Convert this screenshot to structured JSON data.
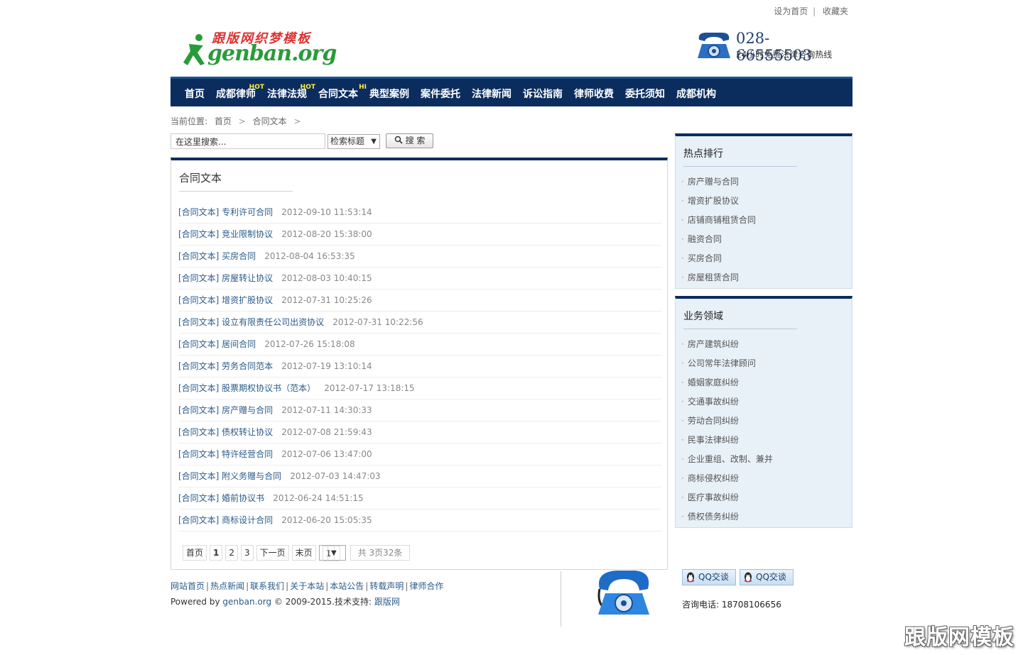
{
  "top_links": [
    "设为首页",
    "收藏夹"
  ],
  "top_sep": "|",
  "logo": {
    "cn": "跟版网织梦模板",
    "en": "genban.org"
  },
  "hotline": {
    "number": "028-66555503",
    "sub": "24小时免费法律咨询热线"
  },
  "nav": [
    {
      "label": "首页",
      "badge": ""
    },
    {
      "label": "成都律师",
      "badge": "HOT"
    },
    {
      "label": "法律法规",
      "badge": "HOT"
    },
    {
      "label": "合同文本",
      "badge": "HI"
    },
    {
      "label": "典型案例",
      "badge": ""
    },
    {
      "label": "案件委托",
      "badge": ""
    },
    {
      "label": "法律新闻",
      "badge": ""
    },
    {
      "label": "诉讼指南",
      "badge": ""
    },
    {
      "label": "律师收费",
      "badge": ""
    },
    {
      "label": "委托须知",
      "badge": ""
    },
    {
      "label": "成都机构",
      "badge": ""
    }
  ],
  "breadcrumb": {
    "prefix": "当前位置:",
    "items": [
      "首页",
      "合同文本"
    ],
    "arrow": ">"
  },
  "search": {
    "value": "在这里搜索...",
    "scope": "检索标题",
    "button": "搜 索"
  },
  "main": {
    "title": "合同文本",
    "items": [
      {
        "title": "[合同文本] 专利许可合同",
        "date": "2012-09-10 11:53:14"
      },
      {
        "title": "[合同文本] 竞业限制协议",
        "date": "2012-08-20 15:38:00"
      },
      {
        "title": "[合同文本] 买房合同",
        "date": "2012-08-04 16:53:35"
      },
      {
        "title": "[合同文本] 房屋转让协议",
        "date": "2012-08-03 10:40:15"
      },
      {
        "title": "[合同文本] 增资扩股协议",
        "date": "2012-07-31 10:25:26"
      },
      {
        "title": "[合同文本] 设立有限责任公司出资协议",
        "date": "2012-07-31 10:22:56"
      },
      {
        "title": "[合同文本] 居间合同",
        "date": "2012-07-26 15:18:08"
      },
      {
        "title": "[合同文本] 劳务合同范本",
        "date": "2012-07-19 13:10:14"
      },
      {
        "title": "[合同文本] 股票期权协议书（范本）",
        "date": "2012-07-17 13:18:15"
      },
      {
        "title": "[合同文本] 房产赠与合同",
        "date": "2012-07-11 14:30:33"
      },
      {
        "title": "[合同文本] 债权转让协议",
        "date": "2012-07-08 21:59:43"
      },
      {
        "title": "[合同文本] 特许经营合同",
        "date": "2012-07-06 13:47:00"
      },
      {
        "title": "[合同文本] 附义务赠与合同",
        "date": "2012-07-03 14:47:03"
      },
      {
        "title": "[合同文本] 婚前协议书",
        "date": "2012-06-24 14:51:15"
      },
      {
        "title": "[合同文本] 商标设计合同",
        "date": "2012-06-20 15:05:35"
      }
    ],
    "pager": {
      "first": "首页",
      "pages": [
        "1",
        "2",
        "3"
      ],
      "next": "下一页",
      "last": "末页",
      "select": "1",
      "info": "共 3页32条"
    }
  },
  "hot_rank": {
    "title": "热点排行",
    "items": [
      "房产赠与合同",
      "增资扩股协议",
      "店铺商铺租赁合同",
      "融资合同",
      "买房合同",
      "房屋租赁合同"
    ]
  },
  "business": {
    "title": "业务领域",
    "items": [
      "房产建筑纠纷",
      "公司常年法律顾问",
      "婚姻家庭纠纷",
      "交通事故纠纷",
      "劳动合同纠纷",
      "民事法律纠纷",
      "企业重组、改制、兼并",
      "商标侵权纠纷",
      "医疗事故纠纷",
      "债权债务纠纷"
    ]
  },
  "footer": {
    "links": [
      "网站首页",
      "热点新闻",
      "联系我们",
      "关于本站",
      "本站公告",
      "转载声明",
      "律师合作"
    ],
    "sep": "|",
    "powered_prefix": "Powered by",
    "powered_link": "genban.org",
    "copyright": "© 2009-2015.技术支持:",
    "support": "跟版网",
    "qq1": "QQ交谈",
    "qq2": "QQ交谈",
    "consult": "咨询电话: 18708106656"
  },
  "watermark": "跟版网模板",
  "colors": {
    "nav_bg": "#0b2d5e",
    "link": "#2b5b8a",
    "side_bg": "#e8f0f8"
  }
}
